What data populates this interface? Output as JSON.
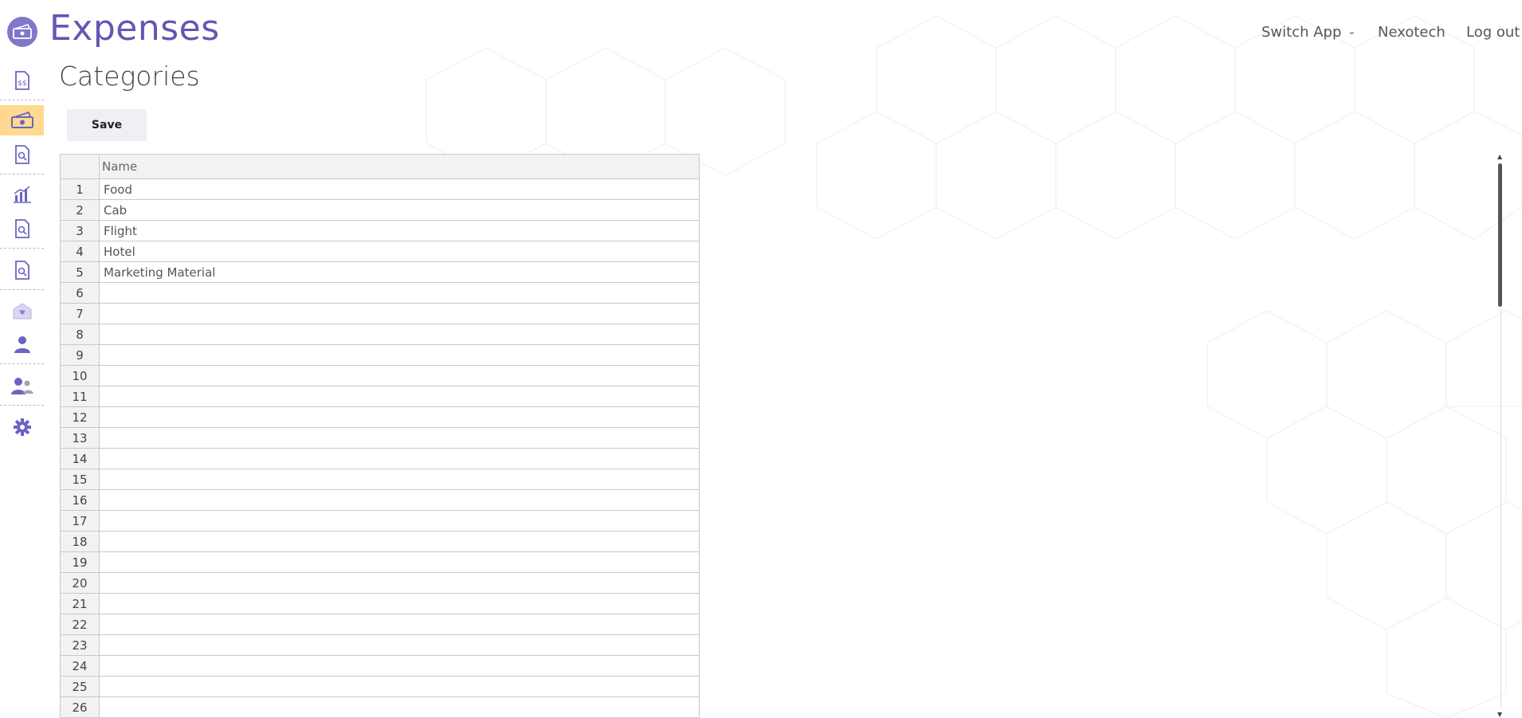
{
  "header": {
    "app_title": "Expenses",
    "nav": {
      "switch_app": "Switch App",
      "organization": "Nexotech",
      "logout": "Log out"
    }
  },
  "sidebar": {
    "items": [
      {
        "icon": "invoice-dollar-icon",
        "active": false
      },
      {
        "icon": "money-bill-icon",
        "active": true
      },
      {
        "icon": "document-search-icon",
        "active": false
      },
      {
        "icon": "bar-chart-icon",
        "active": false
      },
      {
        "icon": "document-search-icon",
        "active": false
      },
      {
        "icon": "document-search-icon",
        "active": false
      },
      {
        "icon": "envelope-heart-icon",
        "active": false
      },
      {
        "icon": "user-icon",
        "active": false
      },
      {
        "icon": "users-icon",
        "active": false
      },
      {
        "icon": "gear-icon",
        "active": false
      }
    ]
  },
  "page": {
    "title": "Categories",
    "save_label": "Save"
  },
  "grid": {
    "column_header": "Name",
    "rows": [
      {
        "num": "1",
        "name": "Food"
      },
      {
        "num": "2",
        "name": "Cab"
      },
      {
        "num": "3",
        "name": "Flight"
      },
      {
        "num": "4",
        "name": "Hotel"
      },
      {
        "num": "5",
        "name": "Marketing Material"
      },
      {
        "num": "6",
        "name": ""
      },
      {
        "num": "7",
        "name": ""
      },
      {
        "num": "8",
        "name": ""
      },
      {
        "num": "9",
        "name": ""
      },
      {
        "num": "10",
        "name": ""
      },
      {
        "num": "11",
        "name": ""
      },
      {
        "num": "12",
        "name": ""
      },
      {
        "num": "13",
        "name": ""
      },
      {
        "num": "14",
        "name": ""
      },
      {
        "num": "15",
        "name": ""
      },
      {
        "num": "16",
        "name": ""
      },
      {
        "num": "17",
        "name": ""
      },
      {
        "num": "18",
        "name": ""
      },
      {
        "num": "19",
        "name": ""
      },
      {
        "num": "20",
        "name": ""
      },
      {
        "num": "21",
        "name": ""
      },
      {
        "num": "22",
        "name": ""
      },
      {
        "num": "23",
        "name": ""
      },
      {
        "num": "24",
        "name": ""
      },
      {
        "num": "25",
        "name": ""
      },
      {
        "num": "26",
        "name": ""
      }
    ]
  },
  "colors": {
    "brand": "#6356b3",
    "icon": "#6b64c4",
    "active_bg": "#fed98f"
  }
}
